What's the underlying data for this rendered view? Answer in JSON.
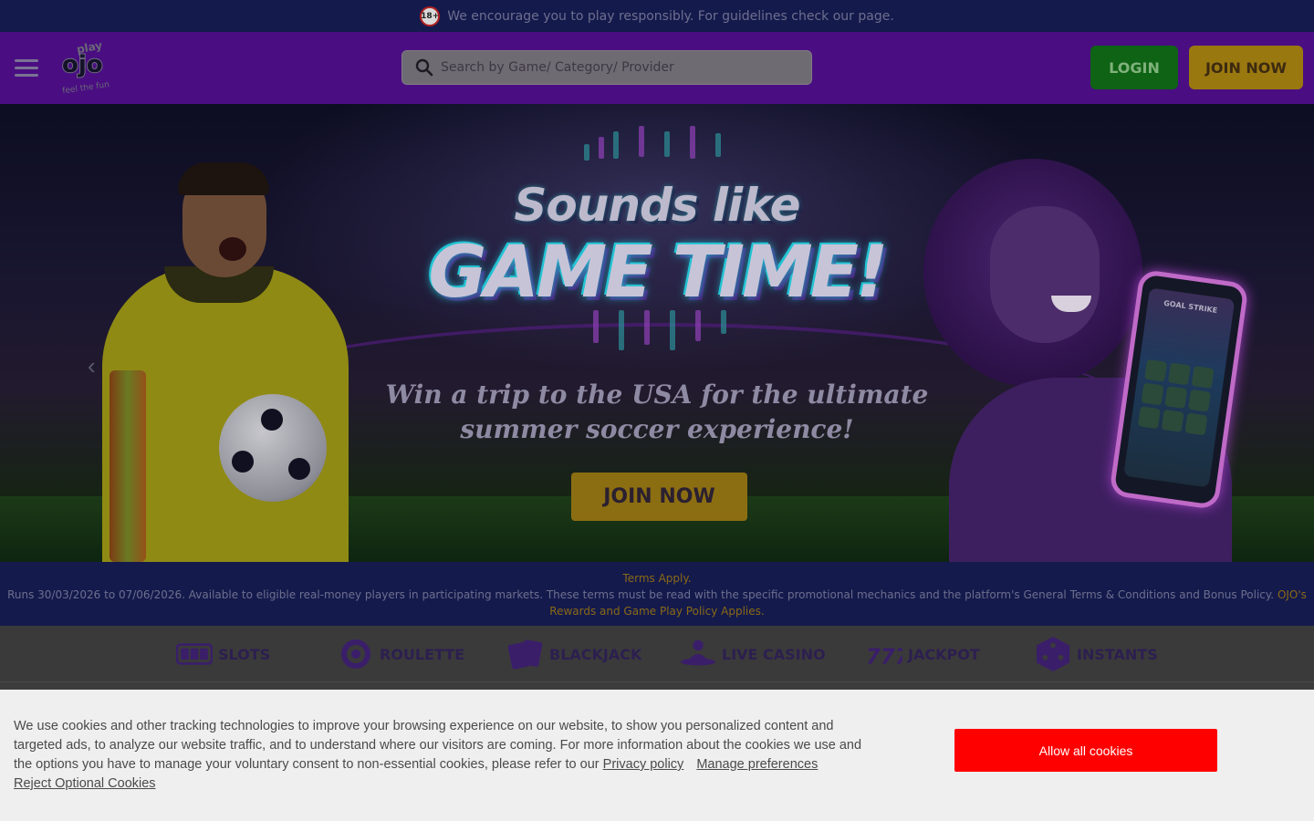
{
  "notice": {
    "age_badge": "18+",
    "text": "We encourage you to play responsibly. For guidelines check our page."
  },
  "header": {
    "logo_text_top": "play",
    "logo_text_main": "ojo",
    "logo_tagline": "feel the fun",
    "search_placeholder": "Search by Game/ Category/ Provider",
    "login_label": "LOGIN",
    "join_label": "JOIN NOW"
  },
  "hero": {
    "title_line1": "Sounds like",
    "title_line2": "GAME TIME!",
    "subtitle_line1": "Win a trip to the USA for the ultimate",
    "subtitle_line2": "summer soccer experience!",
    "cta_label": "JOIN NOW",
    "phone_game_title": "GOAL STRIKE"
  },
  "terms": {
    "heading": "Terms Apply.",
    "body": "Runs 30/03/2026 to 07/06/2026. Available to eligible real-money players in participating markets. These terms must be read with the specific promotional mechanics and the platform's General Terms & Conditions and Bonus Policy.",
    "link": "OJO's Rewards and Game Play Policy Applies."
  },
  "categories": [
    {
      "label": "SLOTS",
      "icon": "slots-icon"
    },
    {
      "label": "ROULETTE",
      "icon": "roulette-icon"
    },
    {
      "label": "BLACKJACK",
      "icon": "cards-icon"
    },
    {
      "label": "LIVE CASINO",
      "icon": "dealer-icon"
    },
    {
      "label": "JACKPOT",
      "icon": "777-icon"
    },
    {
      "label": "INSTANTS",
      "icon": "dice-icon"
    }
  ],
  "cookie": {
    "text": "We use cookies and other tracking technologies to improve your browsing experience on our website, to show you personalized content and targeted ads, to analyze our website traffic, and to understand where our visitors are coming. For more information about the cookies we use and the options you have to manage your voluntary consent to non-essential cookies, please refer to our",
    "privacy_link": "Privacy policy",
    "manage_link": "Manage preferences",
    "reject_link": "Reject Optional Cookies",
    "allow_label": "Allow all cookies"
  },
  "colors": {
    "notice_bg": "#141a4c",
    "header_bg": "#4a0e82",
    "login_bg": "#0f6314",
    "join_bg": "#9a7810",
    "allow_bg": "#ff0000",
    "cookie_bg": "#efefef"
  }
}
